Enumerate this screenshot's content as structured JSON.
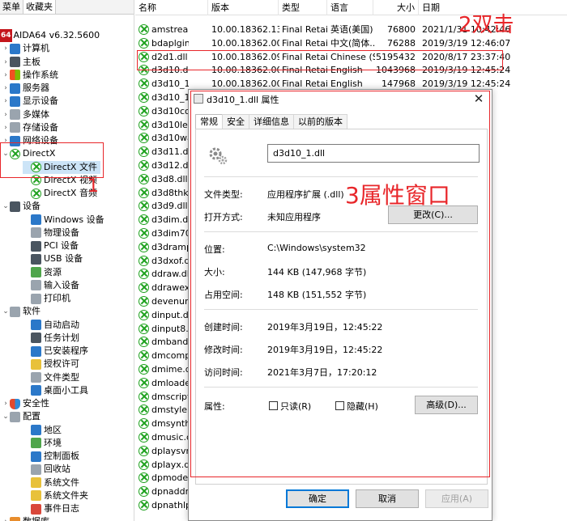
{
  "left_tabs": [
    "菜单",
    "收藏夹"
  ],
  "tree": [
    {
      "label": "AIDA64 v6.32.5600",
      "badge": "64",
      "arrow": "",
      "indent": 0,
      "icon": "aida64-icon"
    },
    {
      "label": "计算机",
      "arrow": "›",
      "indent": 1,
      "icon": "computer-icon"
    },
    {
      "label": "主板",
      "arrow": "›",
      "indent": 1,
      "icon": "motherboard-icon"
    },
    {
      "label": "操作系统",
      "arrow": "›",
      "indent": 1,
      "icon": "windows-icon"
    },
    {
      "label": "服务器",
      "arrow": "›",
      "indent": 1,
      "icon": "server-icon"
    },
    {
      "label": "显示设备",
      "arrow": "›",
      "indent": 1,
      "icon": "display-icon"
    },
    {
      "label": "多媒体",
      "arrow": "›",
      "indent": 1,
      "icon": "multimedia-icon"
    },
    {
      "label": "存储设备",
      "arrow": "›",
      "indent": 1,
      "icon": "storage-icon"
    },
    {
      "label": "网络设备",
      "arrow": "›",
      "indent": 1,
      "icon": "network-icon"
    },
    {
      "label": "DirectX",
      "arrow": "⌄",
      "indent": 1,
      "icon": "directx-icon"
    },
    {
      "label": "DirectX 文件",
      "arrow": "",
      "indent": 2,
      "icon": "directx-icon",
      "selected": true
    },
    {
      "label": "DirectX 视频",
      "arrow": "",
      "indent": 2,
      "icon": "directx-icon"
    },
    {
      "label": "DirectX 音频",
      "arrow": "",
      "indent": 2,
      "icon": "directx-icon"
    },
    {
      "label": "设备",
      "arrow": "⌄",
      "indent": 1,
      "icon": "devices-icon"
    },
    {
      "label": "Windows 设备",
      "arrow": "",
      "indent": 2,
      "icon": "windows-devices-icon"
    },
    {
      "label": "物理设备",
      "arrow": "",
      "indent": 2,
      "icon": "physical-devices-icon"
    },
    {
      "label": "PCI 设备",
      "arrow": "",
      "indent": 2,
      "icon": "pci-icon"
    },
    {
      "label": "USB 设备",
      "arrow": "",
      "indent": 2,
      "icon": "usb-icon"
    },
    {
      "label": "资源",
      "arrow": "",
      "indent": 2,
      "icon": "resources-icon"
    },
    {
      "label": "输入设备",
      "arrow": "",
      "indent": 2,
      "icon": "input-devices-icon"
    },
    {
      "label": "打印机",
      "arrow": "",
      "indent": 2,
      "icon": "printer-icon"
    },
    {
      "label": "软件",
      "arrow": "⌄",
      "indent": 1,
      "icon": "software-icon"
    },
    {
      "label": "自动启动",
      "arrow": "",
      "indent": 2,
      "icon": "autostart-icon"
    },
    {
      "label": "任务计划",
      "arrow": "",
      "indent": 2,
      "icon": "scheduled-tasks-icon"
    },
    {
      "label": "已安装程序",
      "arrow": "",
      "indent": 2,
      "icon": "installed-programs-icon"
    },
    {
      "label": "授权许可",
      "arrow": "",
      "indent": 2,
      "icon": "licenses-icon"
    },
    {
      "label": "文件类型",
      "arrow": "",
      "indent": 2,
      "icon": "file-types-icon"
    },
    {
      "label": "桌面小工具",
      "arrow": "",
      "indent": 2,
      "icon": "desktop-gadgets-icon"
    },
    {
      "label": "安全性",
      "arrow": "›",
      "indent": 1,
      "icon": "security-icon"
    },
    {
      "label": "配置",
      "arrow": "⌄",
      "indent": 1,
      "icon": "config-icon"
    },
    {
      "label": "地区",
      "arrow": "",
      "indent": 2,
      "icon": "region-icon"
    },
    {
      "label": "环境",
      "arrow": "",
      "indent": 2,
      "icon": "environment-icon"
    },
    {
      "label": "控制面板",
      "arrow": "",
      "indent": 2,
      "icon": "control-panel-icon"
    },
    {
      "label": "回收站",
      "arrow": "",
      "indent": 2,
      "icon": "recycle-bin-icon"
    },
    {
      "label": "系统文件",
      "arrow": "",
      "indent": 2,
      "icon": "system-files-icon"
    },
    {
      "label": "系统文件夹",
      "arrow": "",
      "indent": 2,
      "icon": "system-folders-icon"
    },
    {
      "label": "事件日志",
      "arrow": "",
      "indent": 2,
      "icon": "event-log-icon"
    },
    {
      "label": "数据库",
      "arrow": "›",
      "indent": 1,
      "icon": "database-icon"
    }
  ],
  "list_headers": {
    "name": "名称",
    "version": "版本",
    "type": "类型",
    "language": "语言",
    "size": "大小",
    "date": "日期"
  },
  "files": [
    {
      "name": "amstream.dll",
      "version": "10.00.18362.13...",
      "type": "Final Retail",
      "language": "英语(美国)",
      "size": "76800",
      "date": "2021/1/31 10:42:46"
    },
    {
      "name": "bdaplgin.ax",
      "version": "10.00.18362.00...",
      "type": "Final Retail",
      "language": "中文(简体...",
      "size": "76288",
      "date": "2019/3/19 12:46:07"
    },
    {
      "name": "d2d1.dll",
      "version": "10.00.18362.09...",
      "type": "Final Retail",
      "language": "Chinese (S...",
      "size": "5195432",
      "date": "2020/8/17 23:37:40"
    },
    {
      "name": "d3d10.dll",
      "version": "10.00.18362.00...",
      "type": "Final Retail",
      "language": "English",
      "size": "1043968",
      "date": "2019/3/19 12:45:24"
    },
    {
      "name": "d3d10_1.dll",
      "version": "10.00.18362.00...",
      "type": "Final Retail",
      "language": "English",
      "size": "147968",
      "date": "2019/3/19 12:45:24"
    },
    {
      "name": "d3d10_1c",
      "version": "",
      "type": "",
      "language": "",
      "size": "",
      "date": ""
    },
    {
      "name": "d3d10cor",
      "version": "",
      "type": "",
      "language": "",
      "size": "",
      "date": ""
    },
    {
      "name": "d3d10lev",
      "version": "",
      "type": "",
      "language": "",
      "size": "",
      "date": ""
    },
    {
      "name": "d3d10wa",
      "version": "",
      "type": "",
      "language": "",
      "size": "",
      "date": "8"
    },
    {
      "name": "d3d11.dll",
      "version": "",
      "type": "",
      "language": "",
      "size": "",
      "date": ""
    },
    {
      "name": "d3d12.dll",
      "version": "",
      "type": "",
      "language": "",
      "size": "",
      "date": ""
    },
    {
      "name": "d3d8.dll",
      "version": "",
      "type": "",
      "language": "",
      "size": "",
      "date": ""
    },
    {
      "name": "d3d8thk.c",
      "version": "",
      "type": "",
      "language": "",
      "size": "",
      "date": ""
    },
    {
      "name": "d3d9.dll",
      "version": "",
      "type": "",
      "language": "",
      "size": "",
      "date": ""
    },
    {
      "name": "d3dim.dll",
      "version": "",
      "type": "",
      "language": "",
      "size": "",
      "date": ""
    },
    {
      "name": "d3dim700",
      "version": "",
      "type": "",
      "language": "",
      "size": "",
      "date": ""
    },
    {
      "name": "d3dramp.",
      "version": "",
      "type": "",
      "language": "",
      "size": "",
      "date": ""
    },
    {
      "name": "d3dxof.dl",
      "version": "",
      "type": "",
      "language": "",
      "size": "",
      "date": ""
    },
    {
      "name": "ddraw.dll",
      "version": "",
      "type": "",
      "language": "",
      "size": "",
      "date": ""
    },
    {
      "name": "ddrawex.c",
      "version": "",
      "type": "",
      "language": "",
      "size": "",
      "date": ""
    },
    {
      "name": "devenum.",
      "version": "",
      "type": "",
      "language": "",
      "size": "",
      "date": ""
    },
    {
      "name": "dinput.dll",
      "version": "",
      "type": "",
      "language": "",
      "size": "",
      "date": ""
    },
    {
      "name": "dinput8.d",
      "version": "",
      "type": "",
      "language": "",
      "size": "",
      "date": ""
    },
    {
      "name": "dmband.c",
      "version": "",
      "type": "",
      "language": "",
      "size": "",
      "date": ""
    },
    {
      "name": "dmcompo",
      "version": "",
      "type": "",
      "language": "",
      "size": "",
      "date": ""
    },
    {
      "name": "dmime.dll",
      "version": "",
      "type": "",
      "language": "",
      "size": "",
      "date": ""
    },
    {
      "name": "dmloader",
      "version": "",
      "type": "",
      "language": "",
      "size": "",
      "date": ""
    },
    {
      "name": "dmscript.",
      "version": "",
      "type": "",
      "language": "",
      "size": "",
      "date": ""
    },
    {
      "name": "dmstyle.dl",
      "version": "",
      "type": "",
      "language": "",
      "size": "",
      "date": ""
    },
    {
      "name": "dmsynth.c",
      "version": "",
      "type": "",
      "language": "",
      "size": "",
      "date": ""
    },
    {
      "name": "dmusic.dl",
      "version": "",
      "type": "",
      "language": "",
      "size": "",
      "date": ""
    },
    {
      "name": "dplaysvr.e",
      "version": "",
      "type": "",
      "language": "",
      "size": "",
      "date": ""
    },
    {
      "name": "dplayx.dll",
      "version": "",
      "type": "",
      "language": "",
      "size": "",
      "date": ""
    },
    {
      "name": "dpmodem",
      "version": "",
      "type": "",
      "language": "",
      "size": "",
      "date": ""
    },
    {
      "name": "dpnaddr.c",
      "version": "",
      "type": "",
      "language": "",
      "size": "",
      "date": ""
    },
    {
      "name": "dpnathlp.",
      "version": "",
      "type": "",
      "language": "",
      "size": "",
      "date": ""
    }
  ],
  "annotations": {
    "a1": "1",
    "a2": "2双击",
    "a3": "3属性窗口"
  },
  "dialog": {
    "title": "d3d10_1.dll 属性",
    "close": "✕",
    "tabs": [
      "常规",
      "安全",
      "详细信息",
      "以前的版本"
    ],
    "file_name": "d3d10_1.dll",
    "rows": {
      "file_type_label": "文件类型:",
      "file_type": "应用程序扩展 (.dll)",
      "open_with_label": "打开方式:",
      "open_with": "未知应用程序",
      "change_button": "更改(C)...",
      "location_label": "位置:",
      "location": "C:\\Windows\\system32",
      "size_label": "大小:",
      "size": "144 KB (147,968 字节)",
      "disk_size_label": "占用空间:",
      "disk_size": "148 KB (151,552 字节)",
      "created_label": "创建时间:",
      "created": "2019年3月19日，12:45:22",
      "modified_label": "修改时间:",
      "modified": "2019年3月19日，12:45:22",
      "accessed_label": "访问时间:",
      "accessed": "2021年3月7日，17:20:12",
      "attributes_label": "属性:",
      "readonly": "只读(R)",
      "hidden": "隐藏(H)",
      "advanced_button": "高级(D)..."
    },
    "buttons": {
      "ok": "确定",
      "cancel": "取消",
      "apply": "应用(A)"
    }
  },
  "colors": {
    "annotation": "#e8262a",
    "file_icon": "#1ea11e",
    "selection": "#cce4f7"
  }
}
